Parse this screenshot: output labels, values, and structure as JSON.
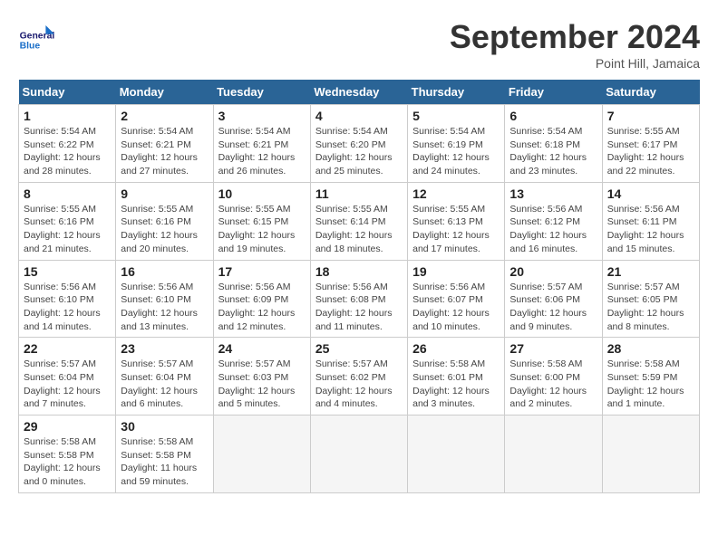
{
  "header": {
    "logo_text_general": "General",
    "logo_text_blue": "Blue",
    "month_title": "September 2024",
    "location": "Point Hill, Jamaica"
  },
  "weekdays": [
    "Sunday",
    "Monday",
    "Tuesday",
    "Wednesday",
    "Thursday",
    "Friday",
    "Saturday"
  ],
  "weeks": [
    [
      {
        "day": "1",
        "sunrise": "5:54 AM",
        "sunset": "6:22 PM",
        "daylight": "12 hours and 28 minutes."
      },
      {
        "day": "2",
        "sunrise": "5:54 AM",
        "sunset": "6:21 PM",
        "daylight": "12 hours and 27 minutes."
      },
      {
        "day": "3",
        "sunrise": "5:54 AM",
        "sunset": "6:21 PM",
        "daylight": "12 hours and 26 minutes."
      },
      {
        "day": "4",
        "sunrise": "5:54 AM",
        "sunset": "6:20 PM",
        "daylight": "12 hours and 25 minutes."
      },
      {
        "day": "5",
        "sunrise": "5:54 AM",
        "sunset": "6:19 PM",
        "daylight": "12 hours and 24 minutes."
      },
      {
        "day": "6",
        "sunrise": "5:54 AM",
        "sunset": "6:18 PM",
        "daylight": "12 hours and 23 minutes."
      },
      {
        "day": "7",
        "sunrise": "5:55 AM",
        "sunset": "6:17 PM",
        "daylight": "12 hours and 22 minutes."
      }
    ],
    [
      {
        "day": "8",
        "sunrise": "5:55 AM",
        "sunset": "6:16 PM",
        "daylight": "12 hours and 21 minutes."
      },
      {
        "day": "9",
        "sunrise": "5:55 AM",
        "sunset": "6:16 PM",
        "daylight": "12 hours and 20 minutes."
      },
      {
        "day": "10",
        "sunrise": "5:55 AM",
        "sunset": "6:15 PM",
        "daylight": "12 hours and 19 minutes."
      },
      {
        "day": "11",
        "sunrise": "5:55 AM",
        "sunset": "6:14 PM",
        "daylight": "12 hours and 18 minutes."
      },
      {
        "day": "12",
        "sunrise": "5:55 AM",
        "sunset": "6:13 PM",
        "daylight": "12 hours and 17 minutes."
      },
      {
        "day": "13",
        "sunrise": "5:56 AM",
        "sunset": "6:12 PM",
        "daylight": "12 hours and 16 minutes."
      },
      {
        "day": "14",
        "sunrise": "5:56 AM",
        "sunset": "6:11 PM",
        "daylight": "12 hours and 15 minutes."
      }
    ],
    [
      {
        "day": "15",
        "sunrise": "5:56 AM",
        "sunset": "6:10 PM",
        "daylight": "12 hours and 14 minutes."
      },
      {
        "day": "16",
        "sunrise": "5:56 AM",
        "sunset": "6:10 PM",
        "daylight": "12 hours and 13 minutes."
      },
      {
        "day": "17",
        "sunrise": "5:56 AM",
        "sunset": "6:09 PM",
        "daylight": "12 hours and 12 minutes."
      },
      {
        "day": "18",
        "sunrise": "5:56 AM",
        "sunset": "6:08 PM",
        "daylight": "12 hours and 11 minutes."
      },
      {
        "day": "19",
        "sunrise": "5:56 AM",
        "sunset": "6:07 PM",
        "daylight": "12 hours and 10 minutes."
      },
      {
        "day": "20",
        "sunrise": "5:57 AM",
        "sunset": "6:06 PM",
        "daylight": "12 hours and 9 minutes."
      },
      {
        "day": "21",
        "sunrise": "5:57 AM",
        "sunset": "6:05 PM",
        "daylight": "12 hours and 8 minutes."
      }
    ],
    [
      {
        "day": "22",
        "sunrise": "5:57 AM",
        "sunset": "6:04 PM",
        "daylight": "12 hours and 7 minutes."
      },
      {
        "day": "23",
        "sunrise": "5:57 AM",
        "sunset": "6:04 PM",
        "daylight": "12 hours and 6 minutes."
      },
      {
        "day": "24",
        "sunrise": "5:57 AM",
        "sunset": "6:03 PM",
        "daylight": "12 hours and 5 minutes."
      },
      {
        "day": "25",
        "sunrise": "5:57 AM",
        "sunset": "6:02 PM",
        "daylight": "12 hours and 4 minutes."
      },
      {
        "day": "26",
        "sunrise": "5:58 AM",
        "sunset": "6:01 PM",
        "daylight": "12 hours and 3 minutes."
      },
      {
        "day": "27",
        "sunrise": "5:58 AM",
        "sunset": "6:00 PM",
        "daylight": "12 hours and 2 minutes."
      },
      {
        "day": "28",
        "sunrise": "5:58 AM",
        "sunset": "5:59 PM",
        "daylight": "12 hours and 1 minute."
      }
    ],
    [
      {
        "day": "29",
        "sunrise": "5:58 AM",
        "sunset": "5:58 PM",
        "daylight": "12 hours and 0 minutes."
      },
      {
        "day": "30",
        "sunrise": "5:58 AM",
        "sunset": "5:58 PM",
        "daylight": "11 hours and 59 minutes."
      },
      null,
      null,
      null,
      null,
      null
    ]
  ],
  "labels": {
    "sunrise": "Sunrise:",
    "sunset": "Sunset:",
    "daylight": "Daylight:"
  }
}
